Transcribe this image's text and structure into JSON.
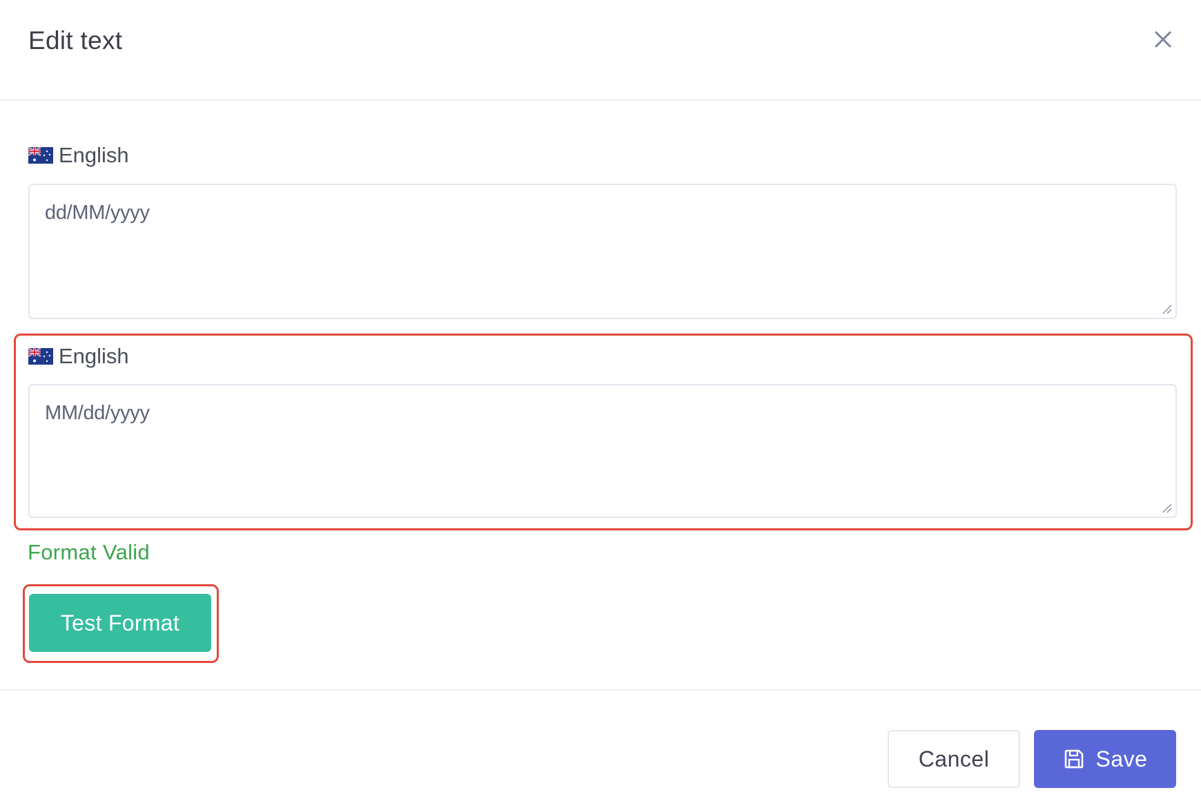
{
  "modal": {
    "title": "Edit text",
    "close_icon": "close-icon"
  },
  "fields": [
    {
      "language": "English",
      "flag_icon": "australia-flag-icon",
      "value": "dd/MM/yyyy"
    },
    {
      "language": "English",
      "flag_icon": "australia-flag-icon",
      "value": "MM/dd/yyyy"
    }
  ],
  "validation": {
    "message": "Format Valid",
    "color": "#3aa64b"
  },
  "actions": {
    "test_label": "Test Format",
    "cancel_label": "Cancel",
    "save_label": "Save",
    "save_icon": "floppy-disk-icon"
  },
  "colors": {
    "test_button": "#36bf9f",
    "save_button": "#5a67d8",
    "highlight": "#e4483a"
  }
}
